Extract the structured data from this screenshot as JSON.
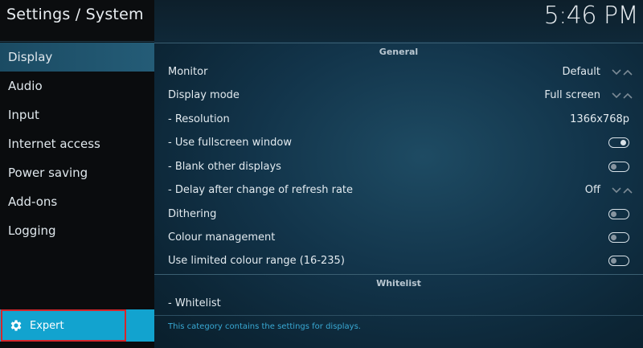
{
  "header": {
    "title": "Settings / System",
    "clock": "5:46 PM"
  },
  "sidebar": {
    "items": [
      {
        "label": "Display"
      },
      {
        "label": "Audio"
      },
      {
        "label": "Input"
      },
      {
        "label": "Internet access"
      },
      {
        "label": "Power saving"
      },
      {
        "label": "Add-ons"
      },
      {
        "label": "Logging"
      }
    ],
    "active": "Display",
    "level_button": {
      "label": "Expert",
      "icon": "gear-icon"
    }
  },
  "sections": {
    "general": {
      "title": "General",
      "rows": [
        {
          "label": "Monitor",
          "value": "Default",
          "control": "spinner"
        },
        {
          "label": "Display mode",
          "value": "Full screen",
          "control": "spinner"
        },
        {
          "label": "- Resolution",
          "value": "1366x768p",
          "control": "none"
        },
        {
          "label": "- Use fullscreen window",
          "control": "toggle",
          "state": true
        },
        {
          "label": "- Blank other displays",
          "control": "toggle",
          "state": false
        },
        {
          "label": "- Delay after change of refresh rate",
          "value": "Off",
          "control": "spinner"
        },
        {
          "label": "Dithering",
          "control": "toggle",
          "state": false
        },
        {
          "label": "Colour management",
          "control": "toggle",
          "state": false
        },
        {
          "label": "Use limited colour range (16-235)",
          "control": "toggle",
          "state": false
        }
      ]
    },
    "whitelist": {
      "title": "Whitelist",
      "rows": [
        {
          "label": "- Whitelist"
        }
      ]
    }
  },
  "footer": {
    "description": "This category contains the settings for displays."
  },
  "colors": {
    "accent": "#12a3cf",
    "highlight_border": "#d5262b",
    "description_text": "#39a9d4"
  }
}
